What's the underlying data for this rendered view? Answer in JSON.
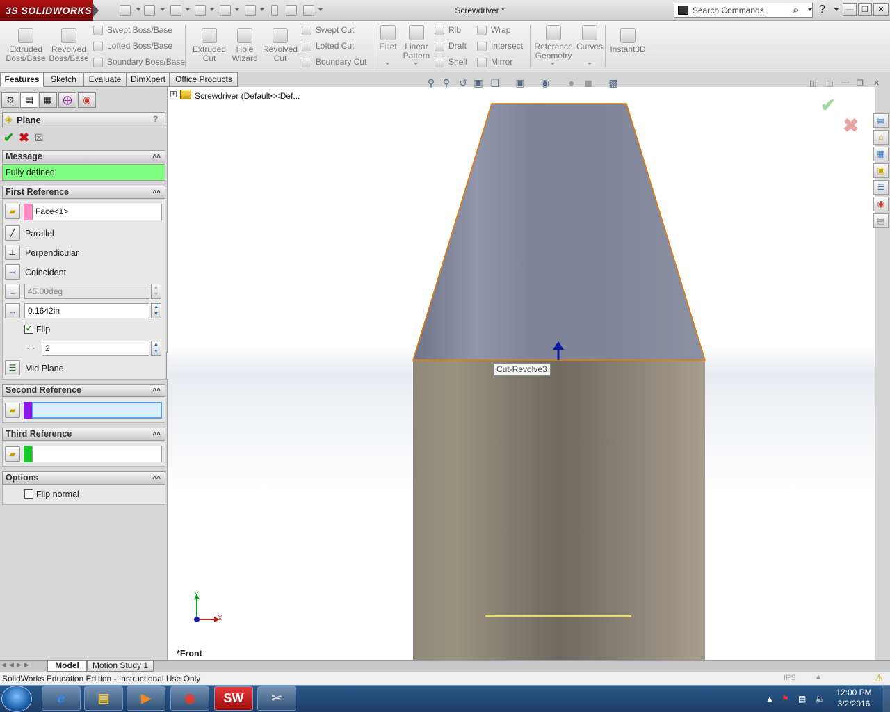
{
  "titlebar": {
    "logo": "3S SOLIDWORKS",
    "doc_title": "Screwdriver *",
    "search_placeholder": "Search Commands",
    "help_icon": "?"
  },
  "ribbon": {
    "groups": [
      {
        "big": [
          {
            "label": "Extruded\nBoss/Base"
          },
          {
            "label": "Revolved\nBoss/Base"
          }
        ],
        "small": [
          "Swept Boss/Base",
          "Lofted Boss/Base",
          "Boundary Boss/Base"
        ]
      },
      {
        "big": [
          {
            "label": "Extruded\nCut"
          },
          {
            "label": "Hole\nWizard"
          },
          {
            "label": "Revolved\nCut"
          }
        ],
        "small": [
          "Swept Cut",
          "Lofted Cut",
          "Boundary Cut"
        ]
      },
      {
        "big": [
          {
            "label": "Fillet"
          },
          {
            "label": "Linear\nPattern"
          }
        ],
        "small": [
          "Rib",
          "Draft",
          "Shell"
        ],
        "small2": [
          "Wrap",
          "Intersect",
          "Mirror"
        ]
      },
      {
        "big": [
          {
            "label": "Reference\nGeometry"
          },
          {
            "label": "Curves"
          },
          {
            "label": "Instant3D"
          }
        ]
      }
    ]
  },
  "tabs": [
    "Features",
    "Sketch",
    "Evaluate",
    "DimXpert",
    "Office Products"
  ],
  "tree": {
    "root": "Screwdriver  (Default<<Def..."
  },
  "panel": {
    "title": "Plane",
    "help": "?",
    "message_head": "Message",
    "message": "Fully defined",
    "first_ref": {
      "head": "First Reference",
      "selection": "Face<1>",
      "options": [
        "Parallel",
        "Perpendicular",
        "Coincident"
      ],
      "angle": "45.00deg",
      "distance": "0.1642in",
      "flip": "Flip",
      "count": "2",
      "mid_plane": "Mid Plane"
    },
    "second_ref": {
      "head": "Second Reference",
      "selection": ""
    },
    "third_ref": {
      "head": "Third Reference",
      "selection": ""
    },
    "options": {
      "head": "Options",
      "flip_normal": "Flip normal"
    }
  },
  "viewport": {
    "tooltip": "Cut-Revolve3",
    "view_label": "*Front",
    "axis_y": "Y",
    "axis_x": "X"
  },
  "bottom_tabs": [
    "Model",
    "Motion Study 1"
  ],
  "status": {
    "text": "SolidWorks Education Edition - Instructional Use Only",
    "units": "IPS"
  },
  "taskbar": {
    "time": "12:00 PM",
    "date": "3/2/2016"
  },
  "colors": {
    "accent_red": "#b01212",
    "message_green": "#7fff7f",
    "edge_orange": "#e87a00"
  }
}
